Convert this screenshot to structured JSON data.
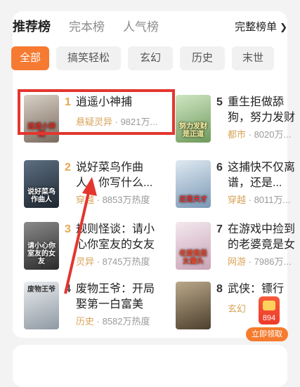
{
  "header": {
    "tabs": [
      "推荐榜",
      "完本榜",
      "人气榜"
    ],
    "full_list": "完整榜单"
  },
  "chips": [
    "全部",
    "搞笑轻松",
    "玄幻",
    "历史",
    "末世"
  ],
  "books_left": [
    {
      "rank": "1",
      "title": "逍遥小神捕",
      "genre": "悬疑灵异",
      "heat": "9821万...",
      "cover_text": "逍遥小神捕"
    },
    {
      "rank": "2",
      "title": "说好菜鸟作曲人，你写什么...",
      "genre": "穿越",
      "heat": "8853万热度",
      "cover_text": "说好菜鸟作曲人"
    },
    {
      "rank": "3",
      "title": "规则怪谈：请小心你室友的女友",
      "genre": "灵异",
      "heat": "8745万热度",
      "cover_text": "请小心你室友的女友"
    },
    {
      "rank": "4",
      "title": "废物王爷：开局娶第一白富美",
      "genre": "历史",
      "heat": "8582万热度",
      "cover_text": "废物王爷"
    }
  ],
  "books_right": [
    {
      "rank": "5",
      "title": "重生拒做舔狗，努力发财是正道",
      "genre": "都市",
      "heat": "8020万...",
      "cover_text": "努力发财是正道"
    },
    {
      "rank": "6",
      "title": "这捕快不仅离谱，还是...",
      "genre": "穿越",
      "heat": "8011万...",
      "cover_text": "还是天才"
    },
    {
      "rank": "7",
      "title": "在游戏中捡到的老婆竟是女魔...",
      "genre": "网游",
      "heat": "7986万...",
      "cover_text": "老婆竟是女魔头"
    },
    {
      "rank": "8",
      "title": "武侠：镖行...",
      "genre": "玄幻",
      "heat": "",
      "cover_text": ""
    }
  ],
  "float": {
    "count": "894",
    "claim": "立即领取"
  },
  "colors": {
    "accent": "#f67a32",
    "highlight": "#e3362f"
  }
}
